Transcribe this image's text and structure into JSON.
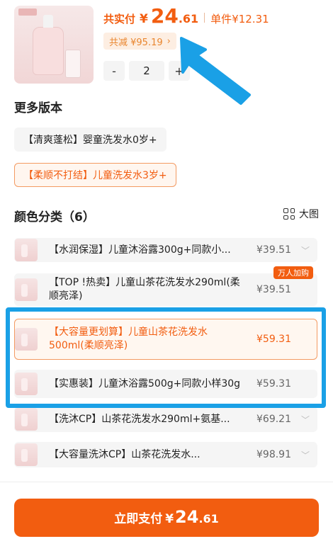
{
  "product": {
    "total_label": "共实付",
    "currency": "¥",
    "total_int": "24",
    "total_dec": ".61",
    "unit_label": "单件",
    "unit_price": "¥12.31",
    "discount_text": "共减 ¥95.19",
    "discount_chevron": "›",
    "qty_minus": "-",
    "qty_value": "2",
    "qty_plus": "+"
  },
  "versions": {
    "title": "更多版本",
    "items": [
      {
        "label": "【清爽蓬松】婴童洗发水0岁+",
        "selected": false
      },
      {
        "label": "【柔顺不打结】儿童洗发水3岁+",
        "selected": true
      }
    ]
  },
  "colors": {
    "title": "颜色分类（6）",
    "view_label": "大图",
    "items": [
      {
        "label": "【水润保湿】儿童沐浴露300g+同款小...",
        "price": "¥39.51",
        "selected": false,
        "chevron": true
      },
      {
        "label": "【TOP !热卖】儿童山茶花洗发水290ml(柔顺亮泽)",
        "price": "¥39.51",
        "selected": false,
        "chevron": false,
        "badge": "万人加购"
      },
      {
        "label": "【大容量更划算】儿童山茶花洗发水500ml(柔顺亮泽)",
        "price": "¥59.31",
        "selected": true,
        "chevron": false
      },
      {
        "label": "【实惠装】儿童沐浴露500g+同款小样30g",
        "price": "¥59.31",
        "selected": false,
        "chevron": false
      },
      {
        "label": "【洗沐CP】山茶花洗发水290ml+氨基...",
        "price": "¥69.21",
        "selected": false,
        "chevron": true
      },
      {
        "label": "【大容量洗沐CP】山茶花洗发水...",
        "price": "¥98.91",
        "selected": false,
        "chevron": true
      }
    ]
  },
  "pay_button": {
    "label": "立即支付",
    "currency": "¥",
    "int": "24",
    "dec": ".61"
  },
  "colors_palette": {
    "accent": "#f25d10",
    "highlight": "#1aa0e6"
  }
}
